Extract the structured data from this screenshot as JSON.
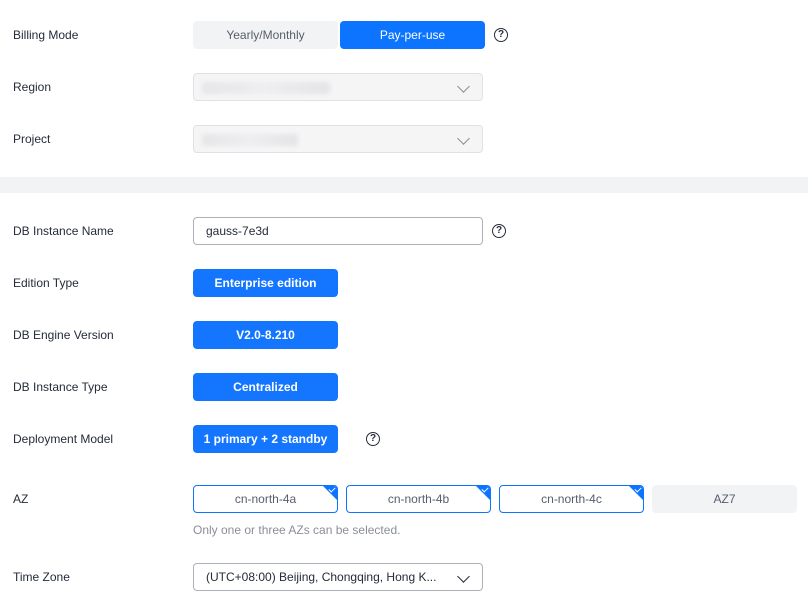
{
  "billing": {
    "label": "Billing Mode",
    "options": [
      "Yearly/Monthly",
      "Pay-per-use"
    ],
    "selected": "Pay-per-use"
  },
  "region": {
    "label": "Region"
  },
  "project": {
    "label": "Project"
  },
  "instance_name": {
    "label": "DB Instance Name",
    "value": "gauss-7e3d"
  },
  "edition": {
    "label": "Edition Type",
    "value": "Enterprise edition"
  },
  "engine_version": {
    "label": "DB Engine Version",
    "value": "V2.0-8.210"
  },
  "instance_type": {
    "label": "DB Instance Type",
    "value": "Centralized"
  },
  "deployment": {
    "label": "Deployment Model",
    "value": "1 primary + 2 standby"
  },
  "az": {
    "label": "AZ",
    "options": [
      "cn-north-4a",
      "cn-north-4b",
      "cn-north-4c",
      "AZ7"
    ],
    "selected": [
      "cn-north-4a",
      "cn-north-4b",
      "cn-north-4c"
    ],
    "hint": "Only one or three AZs can be selected."
  },
  "timezone": {
    "label": "Time Zone",
    "value": "(UTC+08:00) Beijing, Chongqing, Hong K..."
  },
  "help_symbol": "?",
  "colors": {
    "accent": "#0d74ff",
    "muted_bg": "#f2f3f5",
    "text": "#252b3a"
  }
}
